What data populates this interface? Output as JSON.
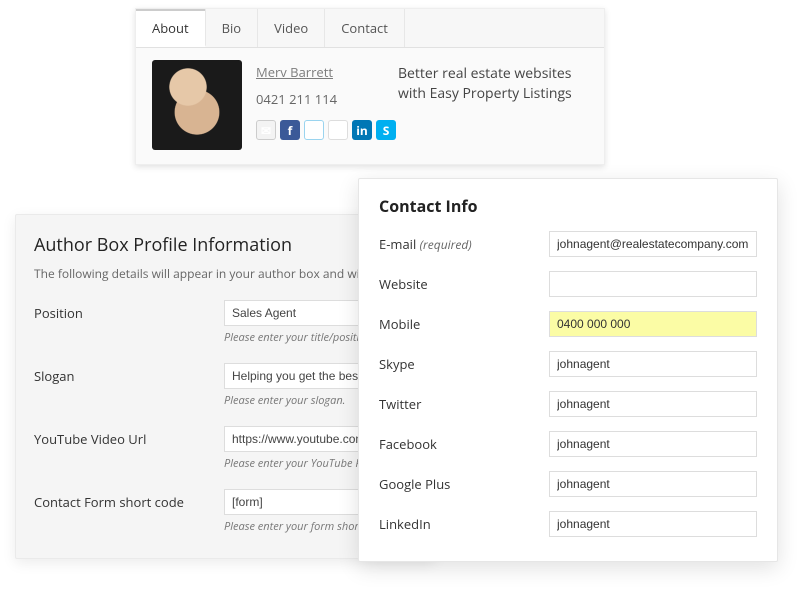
{
  "card": {
    "tabs": [
      "About",
      "Bio",
      "Video",
      "Contact"
    ],
    "active_tab": 0,
    "name": "Merv Barrett",
    "phone": "0421 211 114",
    "slogan": "Better real estate websites with Easy Property Listings",
    "social_icons": [
      "mail",
      "facebook",
      "twitter",
      "google-plus",
      "linkedin",
      "skype"
    ]
  },
  "author_box": {
    "title": "Author Box Profile Information",
    "subtitle": "The following details will appear in your author box and widgets.",
    "fields": [
      {
        "label": "Position",
        "value": "Sales Agent",
        "hint": "Please enter your title/position."
      },
      {
        "label": "Slogan",
        "value": "Helping you get the best ret",
        "hint": "Please enter your slogan."
      },
      {
        "label": "YouTube Video Url",
        "value": "https://www.youtube.com/w",
        "hint": "Please enter your YouTube Profile V"
      },
      {
        "label": "Contact Form short code",
        "value": "[form]",
        "hint": "Please enter your form short code j"
      }
    ]
  },
  "contact_info": {
    "title": "Contact Info",
    "required_text": "(required)",
    "fields": [
      {
        "label": "E-mail",
        "required": true,
        "value": "johnagent@realestatecompany.com.au",
        "highlight": false
      },
      {
        "label": "Website",
        "value": "",
        "highlight": false
      },
      {
        "label": "Mobile",
        "value": "0400 000 000",
        "highlight": true
      },
      {
        "label": "Skype",
        "value": "johnagent",
        "highlight": false
      },
      {
        "label": "Twitter",
        "value": "johnagent",
        "highlight": false
      },
      {
        "label": "Facebook",
        "value": "johnagent",
        "highlight": false
      },
      {
        "label": "Google Plus",
        "value": "johnagent",
        "highlight": false
      },
      {
        "label": "LinkedIn",
        "value": "johnagent",
        "highlight": false
      }
    ]
  }
}
